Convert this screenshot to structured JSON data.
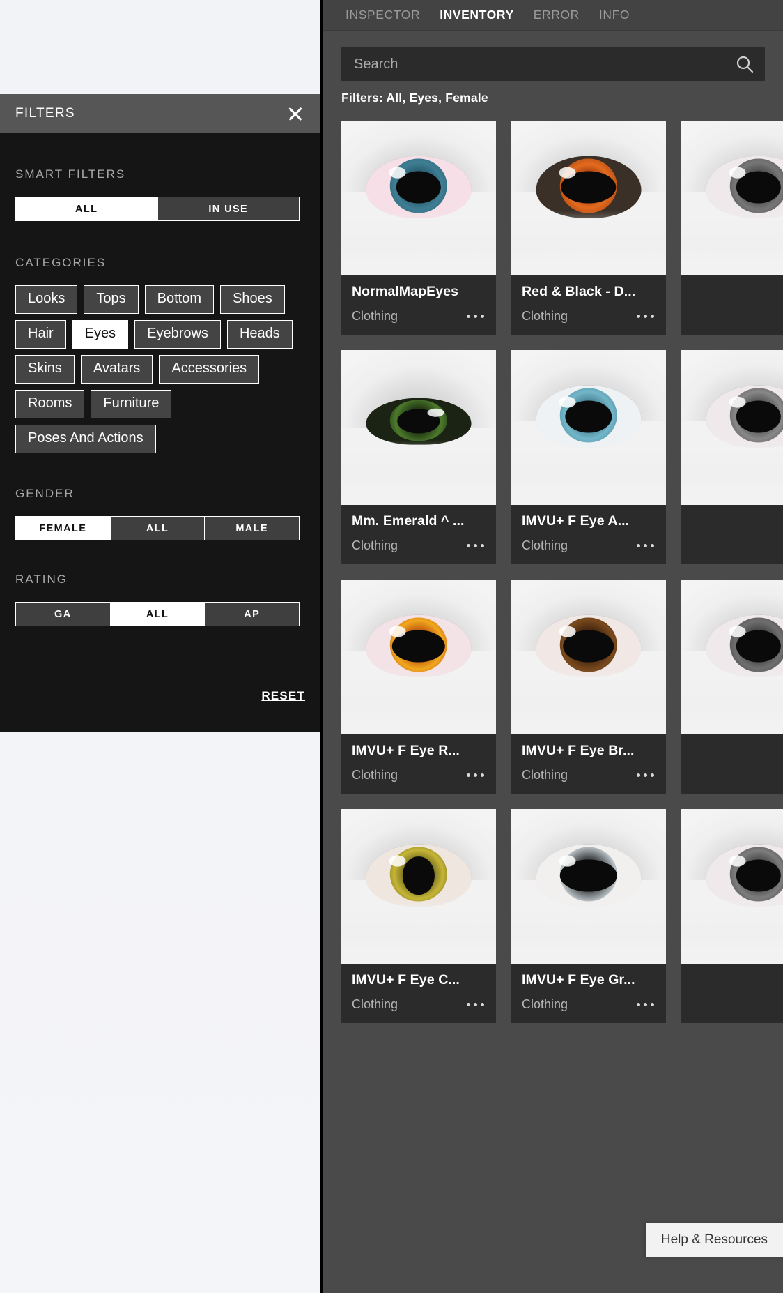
{
  "filters_panel": {
    "header_title": "FILTERS",
    "close_icon": "close-icon",
    "smart_filters": {
      "label": "SMART FILTERS",
      "options": [
        "ALL",
        "IN USE"
      ],
      "selected": "ALL"
    },
    "categories": {
      "label": "CATEGORIES",
      "items": [
        "Looks",
        "Tops",
        "Bottom",
        "Shoes",
        "Hair",
        "Eyes",
        "Eyebrows",
        "Heads",
        "Skins",
        "Avatars",
        "Accessories",
        "Rooms",
        "Furniture",
        "Poses And Actions"
      ],
      "selected": "Eyes"
    },
    "gender": {
      "label": "GENDER",
      "options": [
        "FEMALE",
        "ALL",
        "MALE"
      ],
      "selected": "FEMALE"
    },
    "rating": {
      "label": "RATING",
      "options": [
        "GA",
        "ALL",
        "AP"
      ],
      "selected": "ALL"
    },
    "reset_label": "RESET"
  },
  "inventory": {
    "tabs": [
      {
        "label": "INSPECTOR",
        "active": false
      },
      {
        "label": "INVENTORY",
        "active": true
      },
      {
        "label": "ERROR",
        "active": false
      },
      {
        "label": "INFO",
        "active": false
      }
    ],
    "search": {
      "placeholder": "Search",
      "value": "",
      "icon": "search-icon"
    },
    "filters_summary": "Filters:  All, Eyes, Female",
    "cards": [
      {
        "title": "NormalMapEyes",
        "category": "Clothing",
        "iris": "#3f7e93",
        "iris2": "#1d4a5c",
        "pupil_w": 46,
        "sclera": "#f6dfe6"
      },
      {
        "title": "Red & Black - D...",
        "category": "Clothing",
        "iris": "#e36b1e",
        "iris2": "#7a2307",
        "pupil_w": 52,
        "sclera": "#3a3028"
      },
      {
        "title": "Mm. Emerald ^ ...",
        "category": "Clothing",
        "iris": "#4c7a2c",
        "iris2": "#14220c",
        "pupil_w": 40,
        "sclera": "#1b2414"
      },
      {
        "title": "IMVU+ F Eye A...",
        "category": "Clothing",
        "iris": "#74b6c9",
        "iris2": "#2c6375",
        "pupil_w": 44,
        "sclera": "#eef2f4"
      },
      {
        "title": "IMVU+ F Eye R...",
        "category": "Clothing",
        "iris": "#f0a81e",
        "iris2": "#a32706",
        "pupil_w": 50,
        "sclera": "#f3e3e6"
      },
      {
        "title": "IMVU+ F Eye Br...",
        "category": "Clothing",
        "iris": "#7a4a1e",
        "iris2": "#2e1708",
        "pupil_w": 48,
        "sclera": "#f1e8e6"
      },
      {
        "title": "IMVU+ F Eye C...",
        "category": "Clothing",
        "iris": "#c5b537",
        "iris2": "#4a4710",
        "pupil_w": 40,
        "sclera": "#efe6df"
      },
      {
        "title": "IMVU+ F Eye Gr...",
        "category": "Clothing",
        "iris": "#b9c2c6",
        "iris2": "#3d4548",
        "pupil_w": 54,
        "sclera": "#f2f0ef"
      }
    ],
    "card_menu_icon": "more-options-icon",
    "help_tooltip": "Help & Resources"
  },
  "colors": {
    "panel_bg": "#151515",
    "panel_header": "#565656",
    "right_bg": "#4a4a4a",
    "card_bg": "#2b2b2b",
    "accent_white": "#ffffff"
  }
}
